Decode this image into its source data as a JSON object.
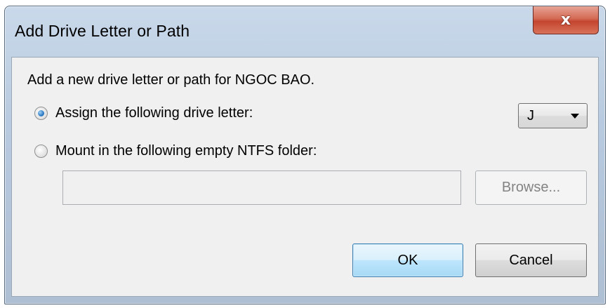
{
  "window": {
    "title": "Add Drive Letter or Path",
    "close_glyph": "x"
  },
  "dialog": {
    "description": "Add a new drive letter or path for NGOC BAO.",
    "options": [
      {
        "label": "Assign the following drive letter:",
        "checked": true
      },
      {
        "label": "Mount in the following empty NTFS folder:",
        "checked": false
      }
    ],
    "drive_letter": {
      "selected": "J"
    },
    "folder_path": {
      "value": ""
    },
    "browse_label": "Browse...",
    "ok_label": "OK",
    "cancel_label": "Cancel"
  },
  "colors": {
    "titlebar": "#c9d9ea",
    "client": "#f0f0f0",
    "close_button": "#c4452f",
    "default_button_border": "#3c7fb1"
  },
  "icons": {
    "close": "close-icon",
    "dropdown": "chevron-down-icon"
  }
}
